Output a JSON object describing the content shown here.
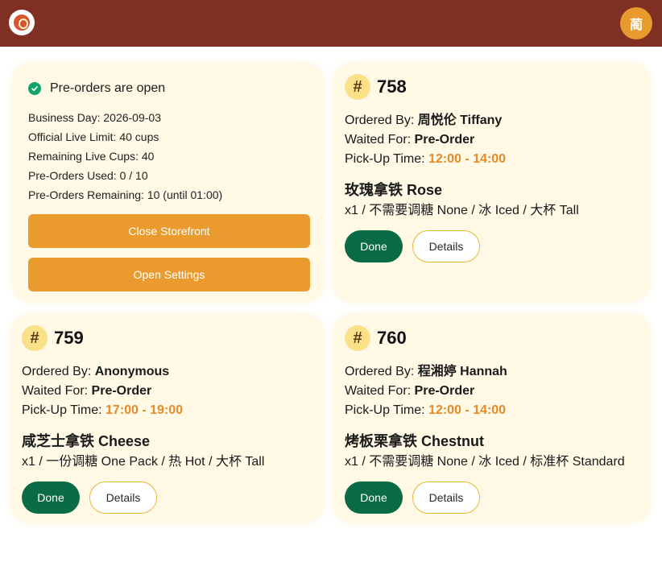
{
  "header": {
    "logo_icon": "coffee-logo-icon",
    "avatar_text": "蔺"
  },
  "status": {
    "title": "Pre-orders are open",
    "lines": [
      "Business Day: 2026-09-03",
      "Official Live Limit: 40 cups",
      "Remaining Live Cups: 40",
      "Pre-Orders Used: 0 / 10",
      "Pre-Orders Remaining: 10 (until 01:00)"
    ],
    "close_label": "Close Storefront",
    "settings_label": "Open Settings"
  },
  "labels": {
    "hash": "#",
    "ordered_by": "Ordered By: ",
    "waited_for": "Waited For: ",
    "pickup": "Pick-Up Time: ",
    "done": "Done",
    "details": "Details"
  },
  "orders": [
    {
      "number": "758",
      "ordered_by": "周悦伦 Tiffany",
      "waited_for": "Pre-Order",
      "pickup": "12:00 - 14:00",
      "item": "玫瑰拿铁 Rose",
      "options": "x1 / 不需要调糖 None / 冰 Iced / 大杯 Tall"
    },
    {
      "number": "759",
      "ordered_by": "Anonymous",
      "waited_for": "Pre-Order",
      "pickup": "17:00 - 19:00",
      "item": "咸芝士拿铁 Cheese",
      "options": "x1 / 一份调糖 One Pack / 热 Hot / 大杯 Tall"
    },
    {
      "number": "760",
      "ordered_by": "程湘婷 Hannah",
      "waited_for": "Pre-Order",
      "pickup": "12:00 - 14:00",
      "item": "烤板栗拿铁 Chestnut",
      "options": "x1 / 不需要调糖 None / 冰 Iced / 标准杯 Standard"
    }
  ],
  "colors": {
    "header_bg": "#7f3023",
    "accent": "#eb9b2d",
    "card_bg": "#fff9e6",
    "done_bg": "#0b6b47",
    "time": "#e68a2a"
  }
}
